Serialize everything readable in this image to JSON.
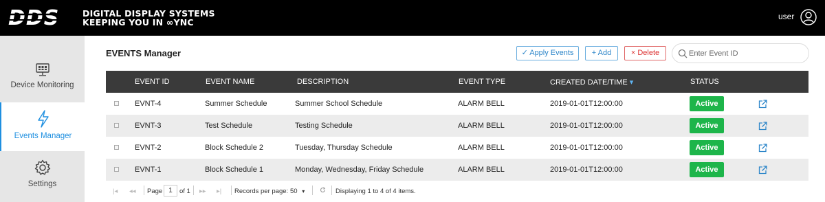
{
  "header": {
    "brand": "DDS",
    "tagline_line1": "DIGITAL  DISPLAY  SYSTEMS",
    "tagline_line2": "KEEPING YOU IN ∞YNC",
    "user_label": "user",
    "user_icon": "user-circle-icon"
  },
  "sidebar": {
    "items": [
      {
        "label": "Device Monitoring",
        "icon": "monitor-icon",
        "active": false
      },
      {
        "label": "Events Manager",
        "icon": "lightning-icon",
        "active": true
      },
      {
        "label": "Settings",
        "icon": "gear-icon",
        "active": false
      }
    ]
  },
  "main": {
    "title": "EVENTS Manager",
    "toolbar": {
      "apply_label": "✓  Apply Events",
      "add_label": "+  Add",
      "delete_label": "×  Delete",
      "search_placeholder": "Enter Event ID"
    },
    "table": {
      "columns": [
        "EVENT ID",
        "EVENT NAME",
        "DESCRIPTION",
        "EVENT TYPE",
        "CREATED DATE/TIME",
        "STATUS"
      ],
      "sort_indicator": "▾",
      "rows": [
        {
          "id": "EVNT-4",
          "name": "Summer Schedule",
          "description": "Summer School Schedule",
          "type": "ALARM BELL",
          "created": "2019-01-01T12:00:00",
          "status": "Active"
        },
        {
          "id": "EVNT-3",
          "name": "Test Schedule",
          "description": "Testing Schedule",
          "type": "ALARM BELL",
          "created": "2019-01-01T12:00:00",
          "status": "Active"
        },
        {
          "id": "EVNT-2",
          "name": "Block Schedule 2",
          "description": "Tuesday, Thursday Schedule",
          "type": "ALARM BELL",
          "created": "2019-01-01T12:00:00",
          "status": "Active"
        },
        {
          "id": "EVNT-1",
          "name": "Block Schedule 1",
          "description": "Monday, Wednesday, Friday Schedule",
          "type": "ALARM BELL",
          "created": "2019-01-01T12:00:00",
          "status": "Active"
        }
      ]
    },
    "pager": {
      "first": "|◂",
      "prev": "◂◂",
      "page_label": "Page",
      "page_value": "1",
      "of_label": "of 1",
      "next": "▸▸",
      "last": "▸|",
      "records_label": "Records per page:",
      "records_value": "50",
      "records_caret": "▾",
      "refresh_icon": "refresh-icon",
      "displaying": "Displaying 1 to 4 of 4 items."
    },
    "colors": {
      "accent": "#1e8fe0",
      "status_active": "#1db54a",
      "delete": "#d33",
      "header_bg": "#000000",
      "table_head_bg": "#3a3a3a"
    }
  }
}
